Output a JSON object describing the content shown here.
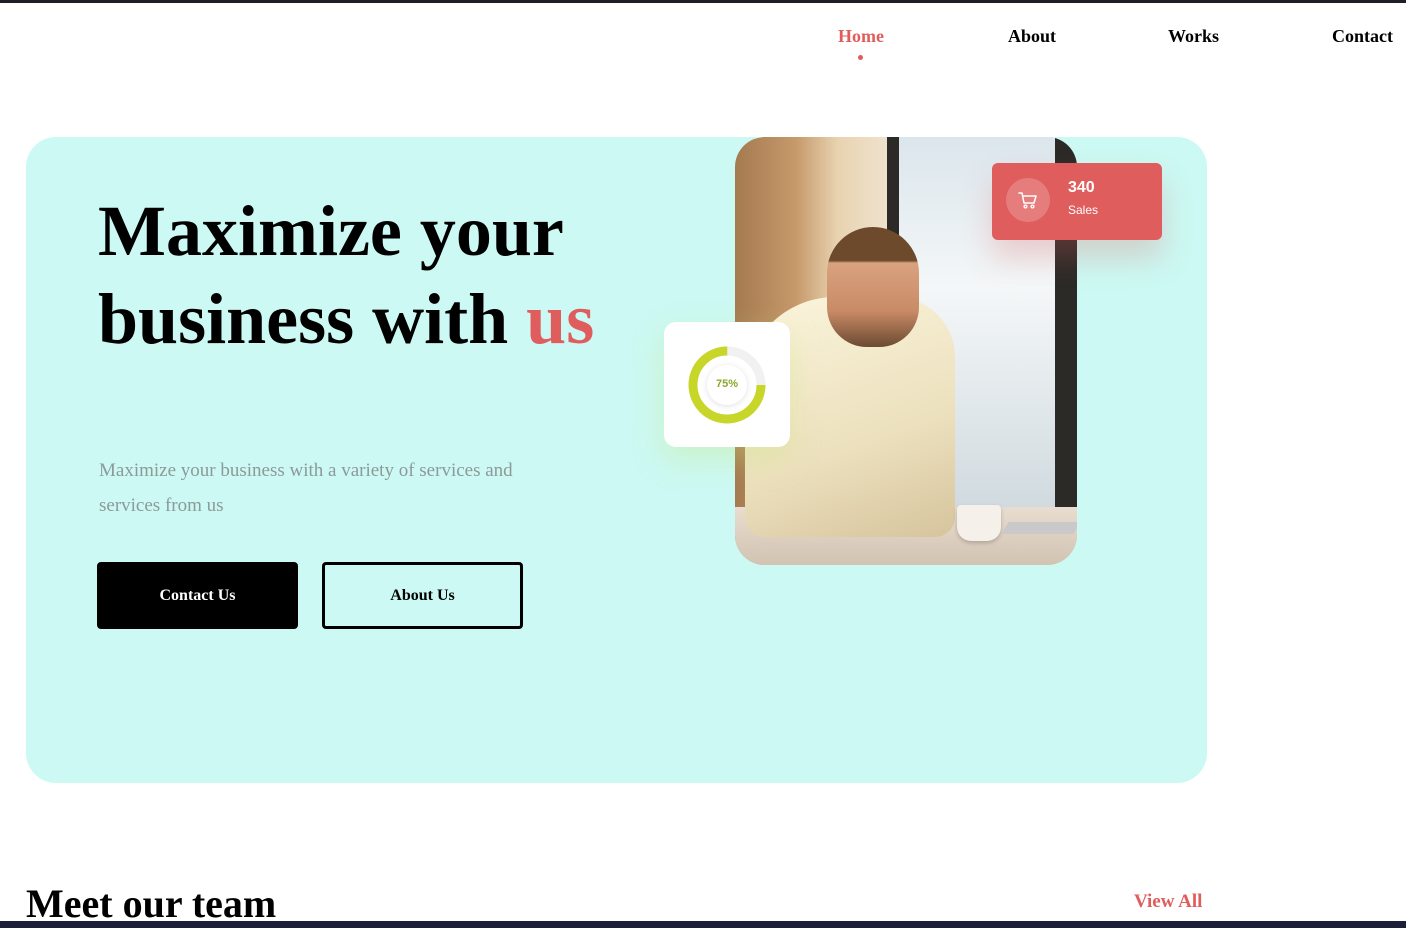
{
  "nav": {
    "items": [
      {
        "label": "Home",
        "active": true
      },
      {
        "label": "About",
        "active": false
      },
      {
        "label": "Works",
        "active": false
      },
      {
        "label": "Contact",
        "active": false
      }
    ]
  },
  "hero": {
    "title_line1": "Maximize your",
    "title_line2": "business with",
    "title_accent": "us",
    "description": "Maximize your business with a variety of services and services from us",
    "primary_button": "Contact Us",
    "secondary_button": "About Us"
  },
  "stats": {
    "sales_value": "340",
    "sales_label": "Sales",
    "sales_icon": "cart-icon",
    "progress_label": "75%",
    "progress_fraction": 0.75
  },
  "team": {
    "title": "Meet our team",
    "view_all": "View All"
  },
  "colors": {
    "accent": "#e05d5d",
    "hero_bg": "#ccf9f3",
    "progress": "#c8d62a"
  }
}
